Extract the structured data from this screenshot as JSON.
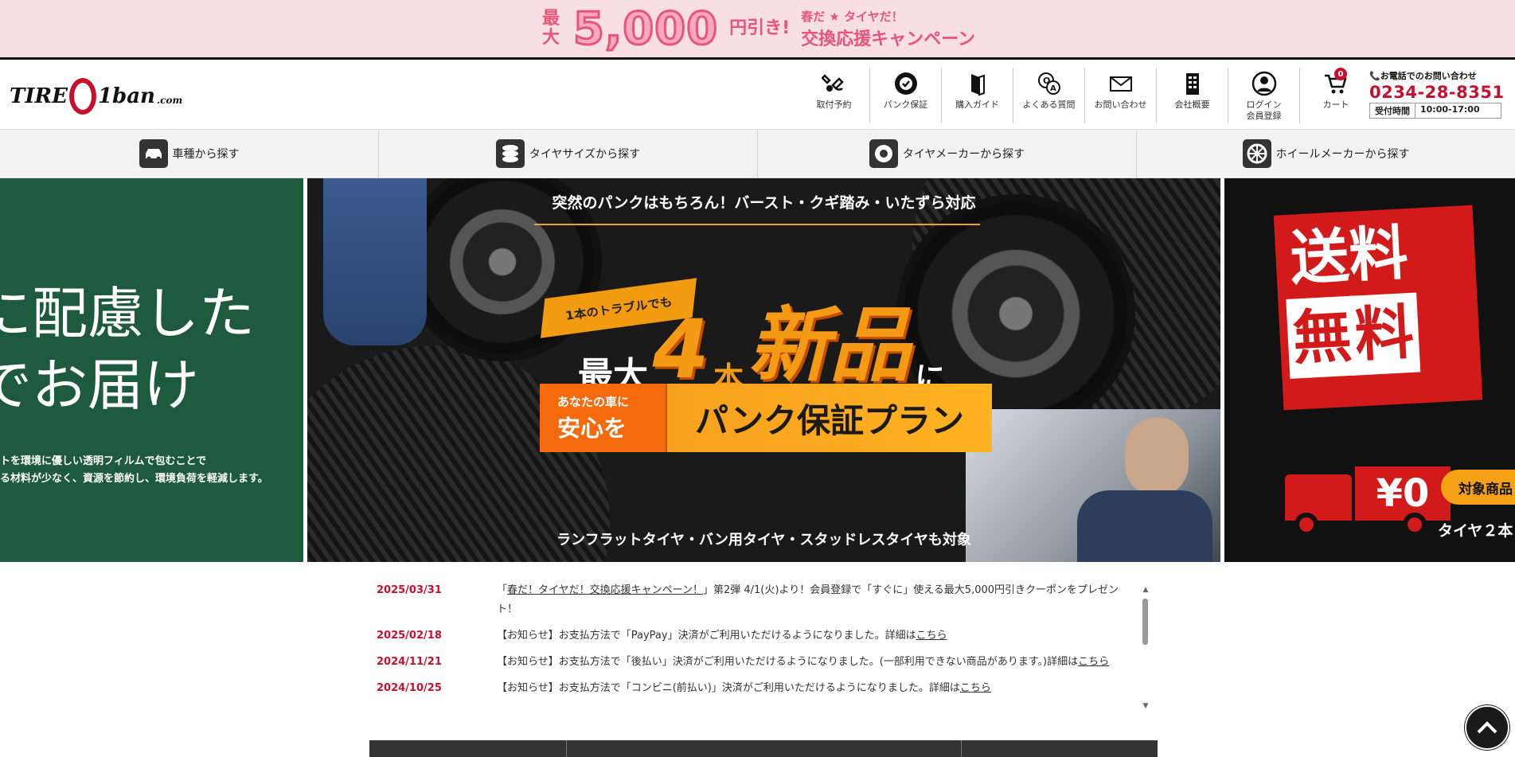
{
  "promo": {
    "max": "最大",
    "amount": "5,000",
    "yen_off": "円引き!",
    "sub": "春だ ★ タイヤだ！",
    "title": "交換応援キャンペーン"
  },
  "header": {
    "logo_text_1": "TIRE",
    "logo_text_2": "1ban",
    "logo_text_3": ".com",
    "nav": [
      {
        "label": "取付予約",
        "icon": "wrench-handshake-icon"
      },
      {
        "label": "パンク保証",
        "icon": "tire-check-icon"
      },
      {
        "label": "購入ガイド",
        "icon": "book-icon"
      },
      {
        "label": "よくある質問",
        "icon": "faq-icon"
      },
      {
        "label": "お問い合わせ",
        "icon": "mail-icon"
      },
      {
        "label": "会社概要",
        "icon": "building-icon"
      },
      {
        "label": "ログイン\n会員登録",
        "label_1": "ログイン",
        "label_2": "会員登録",
        "icon": "user-icon"
      },
      {
        "label": "カート",
        "icon": "cart-icon",
        "badge": "0"
      }
    ],
    "contact": {
      "label": "📞お電話でのお問い合わせ",
      "phone": "0234-28-8351",
      "hours_key": "受付時間",
      "hours_value": "10:00-17:00"
    }
  },
  "categories": [
    {
      "label": "車種から探す",
      "icon": "car-icon"
    },
    {
      "label": "タイヤサイズから探す",
      "icon": "tire-stack-icon"
    },
    {
      "label": "タイヤメーカーから探す",
      "icon": "tire-brand-icon"
    },
    {
      "label": "ホイールメーカーから探す",
      "icon": "wheel-icon"
    }
  ],
  "hero": {
    "left": {
      "line1": "に配慮した",
      "line2": "でお届け",
      "small1": "トを環境に優しい透明フィルムで包むことで",
      "small2": "る材料が少なく、資源を節約し、環境負荷を軽減します。"
    },
    "main": {
      "headline": "突然のパンクはもちろん！バースト・クギ踏み・いたずら対応",
      "tag": "1本のトラブルでも",
      "copy_1": "最大",
      "copy_2": "4",
      "copy_3": "本",
      "copy_4": "新品",
      "copy_5": "に",
      "plan_small": "あなたの車に",
      "plan_big": "安心を",
      "plan_title": "パンク保証プラン",
      "footer": "ランフラットタイヤ・バン用タイヤ・スタッドレスタイヤも対象"
    },
    "right": {
      "w1": "送",
      "w2": "料",
      "w3": "無",
      "w4": "料",
      "price": "¥0",
      "button": "対象商品",
      "sub": "タイヤ２本"
    }
  },
  "news": [
    {
      "date": "2025/03/31",
      "pre": "「",
      "link": "春だ！タイヤだ！交換応援キャンペーン！",
      "post": "」第2弾 4/1(火)より！会員登録で「すぐに」使える最大5,000円引きクーポンをプレゼント！"
    },
    {
      "date": "2025/02/18",
      "pre": "【お知らせ】お支払方法で「PayPay」決済がご利用いただけるようになりました。詳細は",
      "link": "こちら",
      "post": ""
    },
    {
      "date": "2024/11/21",
      "pre": "【お知らせ】お支払方法で「後払い」決済がご利用いただけるようになりました。(一部利用できない商品があります。)詳細は",
      "link": "こちら",
      "post": ""
    },
    {
      "date": "2024/10/25",
      "pre": "【お知らせ】お支払方法で「コンビニ(前払い)」決済がご利用いただけるようになりました。詳細は",
      "link": "こちら",
      "post": ""
    }
  ],
  "colors": {
    "brand_red": "#c8102e",
    "promo_pink": "#f8dfe3",
    "accent_orange": "#f59a14",
    "green_slide": "#1e5a3d"
  }
}
